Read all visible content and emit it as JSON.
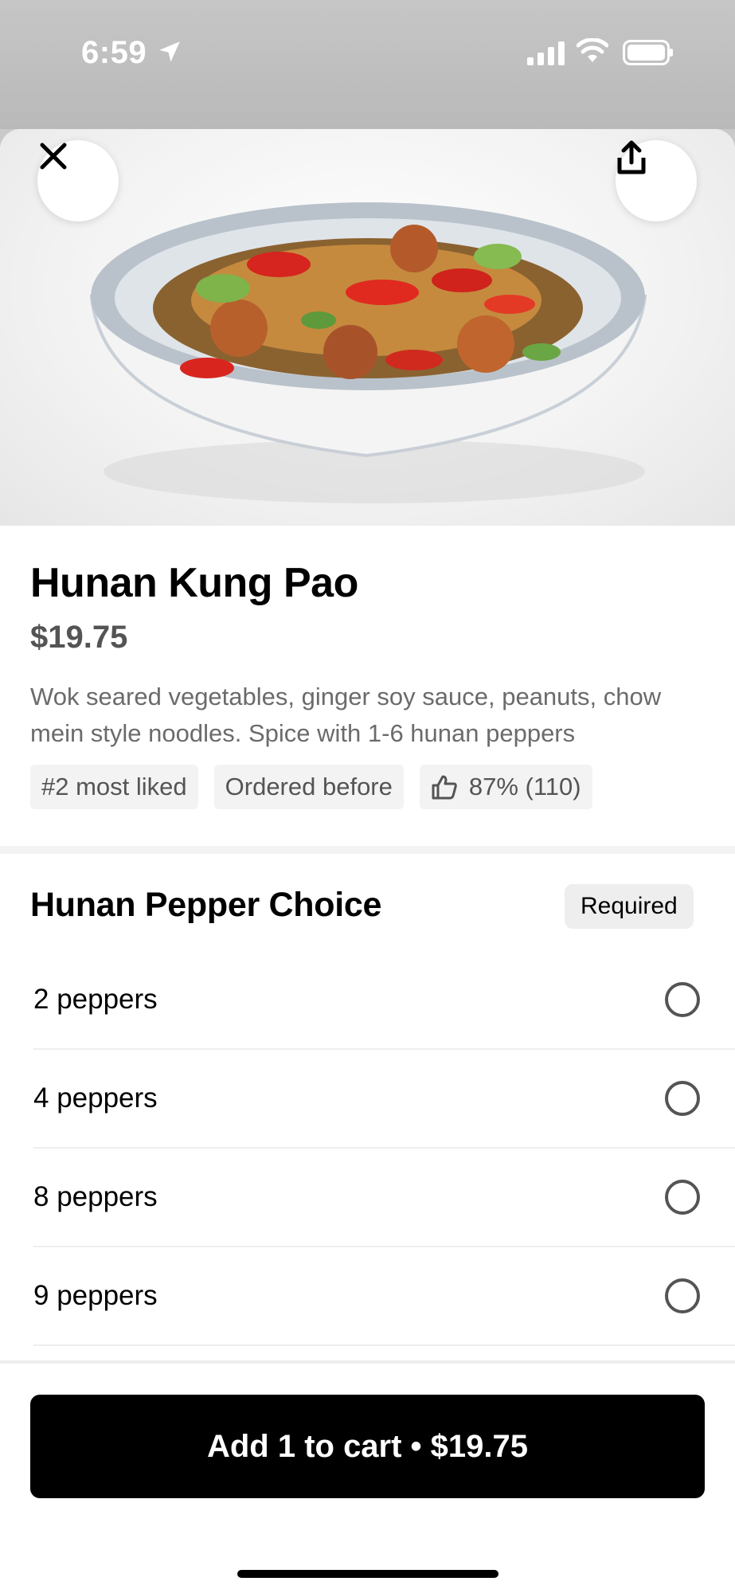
{
  "status_bar": {
    "time": "6:59"
  },
  "item": {
    "title": "Hunan Kung Pao",
    "price": "$19.75",
    "description": "Wok seared vegetables, ginger soy sauce, peanuts, chow mein style noodles. Spice with 1-6 hunan peppers",
    "badges": [
      "#2 most liked",
      "Ordered before",
      "87% (110)"
    ]
  },
  "options_section": {
    "title": "Hunan Pepper Choice",
    "required_label": "Required",
    "options": [
      "2 peppers",
      "4 peppers",
      "8 peppers",
      "9 peppers"
    ]
  },
  "cart_button": {
    "label": "Add 1 to cart • $19.75"
  },
  "icons": {
    "location": "location-arrow-icon",
    "signal": "cellular-signal-icon",
    "wifi": "wifi-icon",
    "battery": "battery-icon",
    "close": "close-icon",
    "share": "share-icon",
    "thumbs_up": "thumbs-up-icon"
  },
  "colors": {
    "button": "#000000",
    "badge_bg": "#f3f3f3",
    "secondary_text": "#545454"
  }
}
